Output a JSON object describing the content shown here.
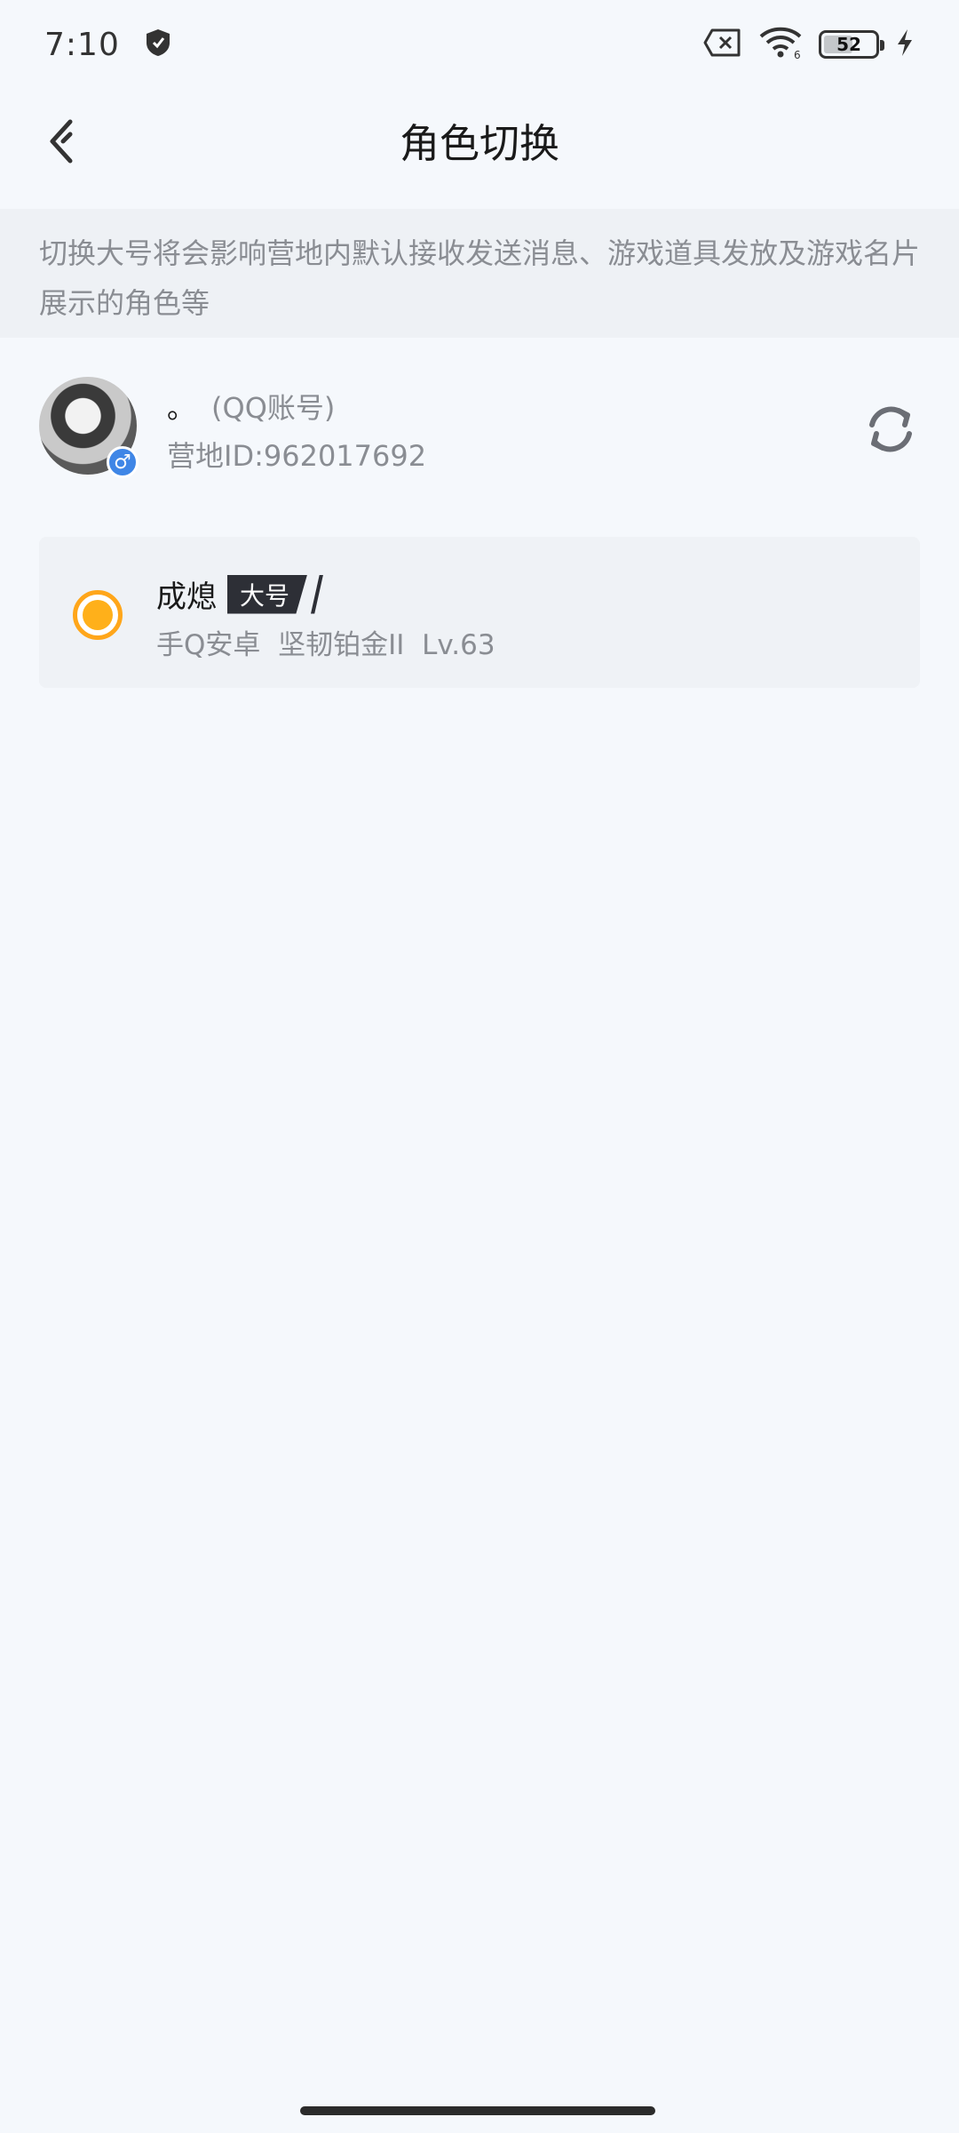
{
  "status_bar": {
    "time": "7:10",
    "battery_level": "52",
    "wifi_label": "6"
  },
  "nav": {
    "title": "角色切换"
  },
  "notice": {
    "text": "切换大号将会影响营地内默认接收发送消息、游戏道具发放及游戏名片展示的角色等"
  },
  "account": {
    "name": "。",
    "type_label": "(QQ账号)",
    "id_label": "营地ID:962017692",
    "gender_symbol": "♂"
  },
  "role": {
    "name": "成熄",
    "tag": "大号",
    "info": "手Q安卓  坚韧铂金II  Lv.63",
    "selected": true
  },
  "colors": {
    "accent_orange": "#ffa61a",
    "background": "#f5f8fc"
  }
}
